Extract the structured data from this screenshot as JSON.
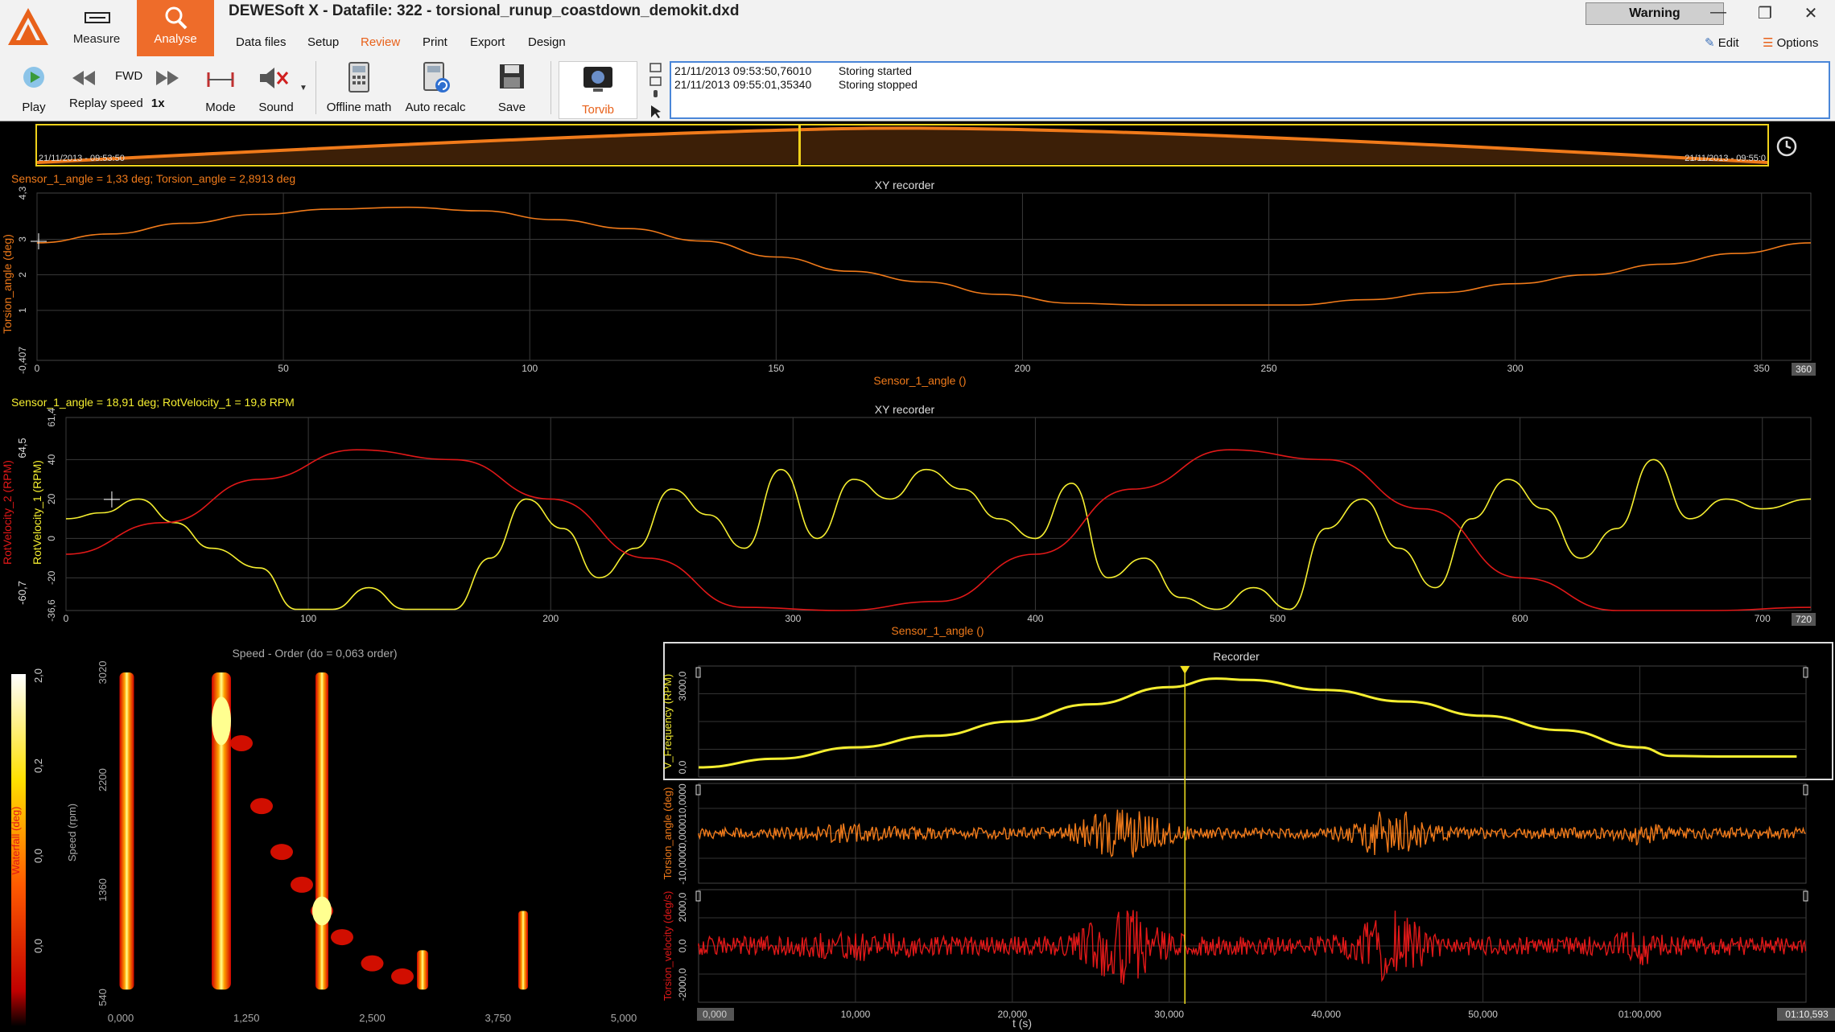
{
  "app": {
    "title": "DEWESoft X - Datafile: 322 - torsional_runup_coastdown_demokit.dxd",
    "warning": "Warning",
    "modes": {
      "measure": "Measure",
      "analyse": "Analyse"
    },
    "menu": [
      "Data files",
      "Setup",
      "Review",
      "Print",
      "Export",
      "Design"
    ],
    "menu_active": "Review",
    "edit": "Edit",
    "options": "Options"
  },
  "toolbar": {
    "play": "Play",
    "fwd": "FWD",
    "replay_speed": "Replay speed",
    "replay_value": "1x",
    "mode": "Mode",
    "sound": "Sound",
    "offline_math": "Offline math",
    "auto_recalc": "Auto recalc",
    "save": "Save",
    "torvib": "Torvib"
  },
  "events": [
    {
      "time": "21/11/2013 09:53:50,76010",
      "text": "Storing started"
    },
    {
      "time": "21/11/2013 09:55:01,35340",
      "text": "Storing stopped"
    }
  ],
  "overview": {
    "start": "21/11/2013 - 09:53:50",
    "end": "21/11/2013 - 09:55:0",
    "cursor_fraction": 0.44
  },
  "xy1": {
    "readout": "Sensor_1_angle = 1,33 deg; Torsion_angle = 2,8913 deg",
    "title": "XY recorder",
    "xlabel": "Sensor_1_angle ()",
    "ylabel": "Torsion_angle (deg)",
    "xticks": [
      "0",
      "50",
      "100",
      "150",
      "200",
      "250",
      "300",
      "350"
    ],
    "xmax_label": "360",
    "yticks": [
      "4,3",
      "3",
      "2",
      "1",
      "-0,407"
    ],
    "color": "#f07a1a",
    "chart_data": {
      "type": "line",
      "xlim": [
        0,
        360
      ],
      "ylim": [
        -0.407,
        4.3
      ],
      "series": [
        {
          "x": [
            0,
            15,
            30,
            45,
            60,
            75,
            90,
            105,
            120,
            135,
            150,
            165,
            180,
            195,
            210,
            225,
            240,
            255,
            270,
            285,
            300,
            315,
            330,
            345,
            360
          ],
          "y": [
            2.9,
            3.15,
            3.45,
            3.7,
            3.85,
            3.9,
            3.8,
            3.55,
            3.3,
            2.95,
            2.5,
            2.1,
            1.8,
            1.45,
            1.2,
            1.15,
            1.15,
            1.15,
            1.3,
            1.5,
            1.75,
            2.0,
            2.3,
            2.6,
            2.9
          ]
        }
      ]
    }
  },
  "xy2": {
    "readout": "Sensor_1_angle = 18,91 deg; RotVelocity_1 = 19,8 RPM",
    "title": "XY recorder",
    "xlabel": "Sensor_1_angle ()",
    "ylabel1": "RotVelocity_1 (RPM)",
    "ylabel2": "RotVelocity_2 (RPM)",
    "xticks": [
      "0",
      "100",
      "200",
      "300",
      "400",
      "500",
      "600",
      "700"
    ],
    "xmax_label": "720",
    "yticks": [
      "61,4",
      "40",
      "20",
      "0",
      "-20",
      "-36,6"
    ],
    "yticks2": [
      "64,5",
      "-60,7"
    ],
    "colors": [
      "#f5ee30",
      "#e01818"
    ],
    "chart_data": {
      "type": "line",
      "xlim": [
        0,
        720
      ],
      "ylim": [
        -36.6,
        61.4
      ],
      "series": [
        {
          "name": "RotVelocity_1",
          "x": [
            0,
            15,
            30,
            45,
            60,
            80,
            95,
            110,
            125,
            140,
            160,
            175,
            190,
            205,
            220,
            235,
            250,
            265,
            280,
            295,
            310,
            325,
            340,
            355,
            370,
            385,
            400,
            415,
            430,
            445,
            460,
            475,
            490,
            505,
            520,
            535,
            550,
            565,
            580,
            595,
            610,
            625,
            640,
            655,
            670,
            685,
            700,
            720
          ],
          "y": [
            10,
            13,
            20,
            8,
            -5,
            -15,
            -36,
            -36,
            -25,
            -36,
            -36,
            -10,
            20,
            5,
            -20,
            -5,
            25,
            12,
            -5,
            35,
            0,
            30,
            20,
            35,
            25,
            10,
            0,
            28,
            -20,
            -10,
            -30,
            -36,
            -25,
            -36,
            5,
            20,
            -5,
            -25,
            10,
            30,
            15,
            -10,
            5,
            40,
            10,
            20,
            15,
            20
          ]
        },
        {
          "name": "RotVelocity_2",
          "x": [
            0,
            40,
            80,
            120,
            160,
            200,
            240,
            280,
            320,
            360,
            400,
            440,
            480,
            520,
            560,
            600,
            640,
            680,
            720
          ],
          "y": [
            -8,
            8,
            30,
            45,
            40,
            20,
            -10,
            -35,
            -45,
            -32,
            -8,
            25,
            45,
            40,
            15,
            -20,
            -40,
            -48,
            -35
          ]
        }
      ]
    }
  },
  "waterfall": {
    "title": "Speed - Order (do = 0,063 order)",
    "ylabel": "Speed (rpm)",
    "colorbar_label": "Waterfall (deg)",
    "colorbar_ticks": [
      "2,0",
      "0,2",
      "0,0",
      "0,0"
    ],
    "yticks": [
      "3020",
      "2200",
      "1360",
      "540"
    ],
    "xticks": [
      "0,000",
      "1,250",
      "2,500",
      "3,750",
      "5,000"
    ],
    "chart_data": {
      "type": "heatmap",
      "xlim": [
        0,
        5
      ],
      "ylim": [
        540,
        3020
      ],
      "ridges": [
        {
          "order": 0.06,
          "speed_range": [
            600,
            3020
          ]
        },
        {
          "order": 1.0,
          "speed_range": [
            600,
            3020
          ]
        },
        {
          "order": 2.0,
          "speed_range": [
            600,
            3020
          ]
        },
        {
          "order": 3.0,
          "speed_range": [
            600,
            900
          ]
        },
        {
          "order": 4.0,
          "speed_range": [
            600,
            1200
          ]
        }
      ]
    }
  },
  "recorder": {
    "title": "Recorder",
    "channels": [
      {
        "label": "V_Frequency (RPM)",
        "ticks": [
          "3000,0",
          "0,0"
        ],
        "color": "#f5ee30"
      },
      {
        "label": "Torsion_angle (deg)",
        "ticks": [
          "10,0000",
          "0,0000",
          "-10,0000"
        ],
        "color": "#f07a1a"
      },
      {
        "label": "Torsion_velocity (deg/s)",
        "ticks": [
          "2000,0",
          "0,0",
          "-2000,0"
        ],
        "color": "#e01818"
      }
    ],
    "xticks": [
      "0,000",
      "10,000",
      "20,000",
      "30,000",
      "40,000",
      "50,000",
      "01:00,000"
    ],
    "xmax_label": "01:10,593",
    "xlabel": "t (s)",
    "cursor_time": 31.0,
    "chart_data": {
      "type": "line",
      "xlim": [
        0,
        70.593
      ],
      "series": [
        {
          "name": "V_Frequency (RPM)",
          "x": [
            0,
            5,
            10,
            15,
            20,
            25,
            30,
            33,
            35,
            40,
            45,
            50,
            55,
            60,
            62,
            65,
            70
          ],
          "y": [
            0,
            300,
            700,
            1100,
            1600,
            2200,
            2800,
            3100,
            3050,
            2700,
            2300,
            1800,
            1300,
            700,
            400,
            380,
            380
          ]
        }
      ]
    }
  }
}
